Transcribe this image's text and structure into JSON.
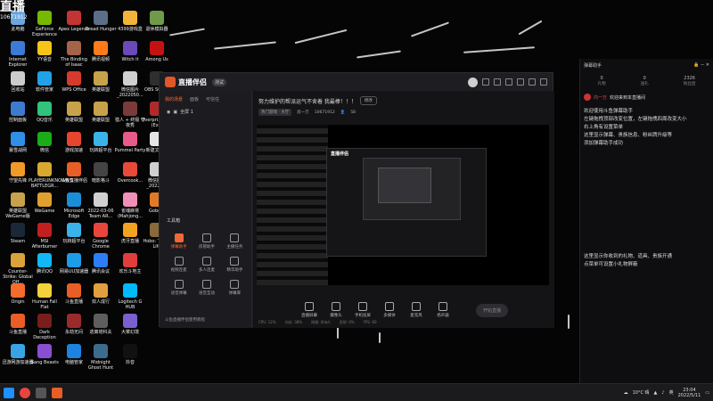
{
  "overlay": {
    "live": "直播",
    "number": "10671912"
  },
  "desktop_icons": [
    {
      "label": "此电脑",
      "color": "#6aa6e0"
    },
    {
      "label": "Internet Explorer",
      "color": "#3b7bd6"
    },
    {
      "label": "回收站",
      "color": "#cccccc"
    },
    {
      "label": "控制面板",
      "color": "#3d7bd0"
    },
    {
      "label": "暴雪战网",
      "color": "#2f8fe8"
    },
    {
      "label": "守望先锋",
      "color": "#f09a2a"
    },
    {
      "label": "英雄联盟 WeGame版",
      "color": "#c8a24a"
    },
    {
      "label": "Steam",
      "color": "#1b2838"
    },
    {
      "label": "Counter-Strike: Global Off...",
      "color": "#d9a23a"
    },
    {
      "label": "Origin",
      "color": "#f56c2d"
    },
    {
      "label": "斗鱼直播",
      "color": "#e85e26"
    },
    {
      "label": "迅游网游加速器",
      "color": "#39a3e6"
    },
    {
      "label": "GeForce Experience",
      "color": "#76b900"
    },
    {
      "label": "YY语音",
      "color": "#f7c51a"
    },
    {
      "label": "软件管家",
      "color": "#22a0e8"
    },
    {
      "label": "QQ音乐",
      "color": "#31c27c"
    },
    {
      "label": "微信",
      "color": "#1aad19"
    },
    {
      "label": "PLAYERUNKNOWN'S BATTLEGR...",
      "color": "#d8a830"
    },
    {
      "label": "WeGame",
      "color": "#e0a030"
    },
    {
      "label": "MSI Afterburner",
      "color": "#c21f1f"
    },
    {
      "label": "腾讯QQ",
      "color": "#12b7f5"
    },
    {
      "label": "Human Fall Flat",
      "color": "#f2d13a"
    },
    {
      "label": "Dark Deception",
      "color": "#7a1d1d"
    },
    {
      "label": "Gang Beasts",
      "color": "#8a4fd0"
    },
    {
      "label": "Apex Legends",
      "color": "#c33434"
    },
    {
      "label": "The Binding of Isaac",
      "color": "#a5634a"
    },
    {
      "label": "WPS Office",
      "color": "#d53a2c"
    },
    {
      "label": "英雄联盟",
      "color": "#c8a24a"
    },
    {
      "label": "游戏加速",
      "color": "#e8452f"
    },
    {
      "label": "斗鱼直播伴侣",
      "color": "#e85e26"
    },
    {
      "label": "Microsoft Edge",
      "color": "#1a8fd8"
    },
    {
      "label": "玩转超平台",
      "color": "#3bb2e8"
    },
    {
      "label": "网易UU加速器",
      "color": "#1d9ce8"
    },
    {
      "label": "斗鱼直播",
      "color": "#e85e26"
    },
    {
      "label": "永劫无间",
      "color": "#9b2b2b"
    },
    {
      "label": "电脑管家",
      "color": "#1d82e0"
    },
    {
      "label": "Dread Hunger",
      "color": "#5b6f88"
    },
    {
      "label": "腾讯视频",
      "color": "#ff7a1a"
    },
    {
      "label": "英雄联盟",
      "color": "#c8a24a"
    },
    {
      "label": "英雄联盟",
      "color": "#c8a24a"
    },
    {
      "label": "玩转超平台",
      "color": "#3bb2e8"
    },
    {
      "label": "暗影格斗",
      "color": "#444444"
    },
    {
      "label": "2022-03-06 Team AR...",
      "color": "#d0d0d0"
    },
    {
      "label": "Google Chrome",
      "color": "#e8453c"
    },
    {
      "label": "腾讯会议",
      "color": "#2c7ef5"
    },
    {
      "label": "双人成行",
      "color": "#e0a040"
    },
    {
      "label": "逃离塔科夫",
      "color": "#5e5e5e"
    },
    {
      "label": "Midnight Ghost Hunt",
      "color": "#3b6c8c"
    },
    {
      "label": "4399游戏盒",
      "color": "#f2b33a"
    },
    {
      "label": "Witch it",
      "color": "#6a49b8"
    },
    {
      "label": "微信图片_2022050...",
      "color": "#d0d0d0"
    },
    {
      "label": "猎人 + 终极 守夜秀",
      "color": "#7a3a3a"
    },
    {
      "label": "Pummel Party",
      "color": "#e85a8a"
    },
    {
      "label": "Overcook...",
      "color": "#e84a3a"
    },
    {
      "label": "雀魂麻将 (Mahjong...",
      "color": "#f08fb8"
    },
    {
      "label": "虎牙直播",
      "color": "#f2a31f"
    },
    {
      "label": "欢乐斗地主",
      "color": "#e23d3d"
    },
    {
      "label": "Logitech G HUB",
      "color": "#00b8fc"
    },
    {
      "label": "大菜幻境",
      "color": "#7a5fd0"
    },
    {
      "label": "抖音",
      "color": "#111111"
    },
    {
      "label": "退休模拟器",
      "color": "#6f9a4a"
    },
    {
      "label": "Among Us",
      "color": "#c51111"
    },
    {
      "label": "OBS Studio",
      "color": "#302e31"
    },
    {
      "label": "Overpri... CBT (Ex...",
      "color": "#b02a2a"
    },
    {
      "label": "新建文本...",
      "color": "#e6e6e6"
    },
    {
      "label": "微信图片_20220...",
      "color": "#d0d0d0"
    },
    {
      "label": "Gobe...",
      "color": "#e07a2a"
    },
    {
      "label": "Hobo: Tough Life",
      "color": "#8a6a3a"
    }
  ],
  "app": {
    "name": "直播伴侣",
    "version": "测试",
    "left_tabs": [
      "我的场景",
      "面板",
      "可信任"
    ],
    "scene": "全屏 1",
    "tools_title": "工具箱",
    "tools": [
      {
        "label": "弹幕助手",
        "active": true
      },
      {
        "label": "房管助手",
        "active": false
      },
      {
        "label": "主播任务",
        "active": false
      },
      {
        "label": "视频连麦",
        "active": false
      },
      {
        "label": "多人连麦",
        "active": false
      },
      {
        "label": "精华助手",
        "active": false
      },
      {
        "label": "语音弹幕",
        "active": false
      },
      {
        "label": "语音互动",
        "active": false
      },
      {
        "label": "弹幕库",
        "active": false
      }
    ],
    "notice": "斗鱼直播伴侣使用教程",
    "room_title": "努力维护的帮派运气不舍着 我最棒！！！",
    "room_tag": "修改",
    "room_category": "热门游戏 · 大厅",
    "room_label": "房一万",
    "room_id": "10671912",
    "viewers": "58",
    "controls": [
      "直播屏幕",
      "摄像头",
      "手机投屏",
      "多媒体",
      "麦克风",
      "扬声器"
    ],
    "start_button": "开始直播",
    "status": [
      "CPU: 12%",
      "内存: 38%",
      "网络: 0kb/s",
      "丢帧: 0%",
      "FPS: 60"
    ]
  },
  "chat": {
    "title": "弹幕助手",
    "stats": [
      {
        "value": "0",
        "label": "礼物"
      },
      {
        "value": "0",
        "label": "送礼"
      },
      {
        "value": "2326",
        "label": "粉丝团"
      }
    ],
    "welcome_user": "内一万",
    "welcome_text": "欢迎来到本直播间",
    "lines": [
      "欢迎使用斗鱼弹幕助手",
      "左键拖拽顶部改变位置，左键拖拽四周改变大小",
      "右上角有设置菜单",
      "这里显示弹幕、贵族信息、粉丝牌升级等",
      "添加弹幕助手成功"
    ],
    "lines2": [
      "这里显示你收到的礼物、道具、贵族开通",
      "点菜单可设置小礼物屏蔽"
    ]
  },
  "taskbar": {
    "weather": "10°C 晴",
    "time": "23:04",
    "date": "2022/5/11",
    "lang": "英"
  }
}
